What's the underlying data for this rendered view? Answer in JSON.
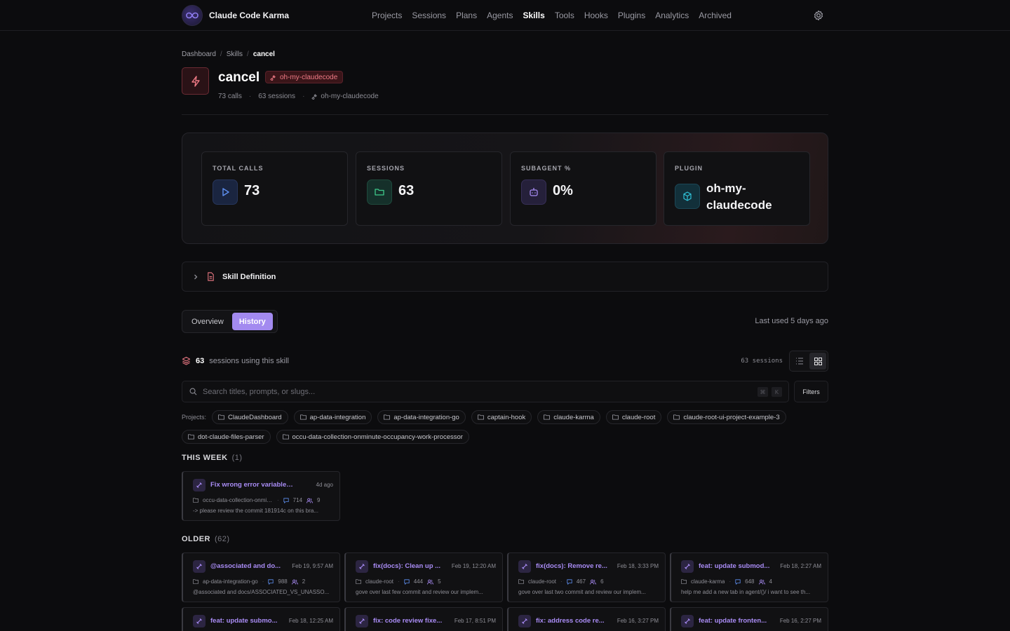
{
  "app": {
    "name": "Claude Code Karma"
  },
  "nav": [
    "Projects",
    "Sessions",
    "Plans",
    "Agents",
    "Skills",
    "Tools",
    "Hooks",
    "Plugins",
    "Analytics",
    "Archived"
  ],
  "nav_active": "Skills",
  "breadcrumb": [
    "Dashboard",
    "Skills",
    "cancel"
  ],
  "skill": {
    "name": "cancel",
    "plugin_badge": "oh-my-claudecode",
    "calls": "73 calls",
    "sessions": "63 sessions",
    "plugin": "oh-my-claudecode"
  },
  "stats": [
    {
      "label": "TOTAL CALLS",
      "value": "73",
      "icon": "play-icon",
      "color": "#5e8ff0"
    },
    {
      "label": "SESSIONS",
      "value": "63",
      "icon": "folder-icon",
      "color": "#3fc98b"
    },
    {
      "label": "SUBAGENT %",
      "value": "0%",
      "icon": "bot-icon",
      "color": "#a98cf5"
    },
    {
      "label": "PLUGIN",
      "value": "oh-my-claudecode",
      "icon": "package-icon",
      "color": "#2fc0d6"
    }
  ],
  "skill_definition_label": "Skill Definition",
  "tabs": [
    "Overview",
    "History"
  ],
  "active_tab": "History",
  "last_used": "Last used 5 days ago",
  "sessions_header": {
    "count": "63",
    "text": "sessions using this skill",
    "right_count": "63 sessions"
  },
  "search": {
    "placeholder": "Search titles, prompts, or slugs...",
    "value": "",
    "kbd1": "⌘",
    "kbd2": "K"
  },
  "filters_label": "Filters",
  "projects_label": "Projects:",
  "projects": [
    "ClaudeDashboard",
    "ap-data-integration",
    "ap-data-integration-go",
    "captain-hook",
    "claude-karma",
    "claude-root",
    "claude-root-ui-project-example-3",
    "dot-claude-files-parser",
    "occu-data-collection-onminute-occupancy-work-processor"
  ],
  "this_week": {
    "title": "THIS WEEK",
    "count": "(1)"
  },
  "older": {
    "title": "OLDER",
    "count": "(62)"
  },
  "this_week_cards": [
    {
      "title": "Fix wrong error variable and ...",
      "when": "4d ago",
      "project": "occu-data-collection-onminute...",
      "messages": "714",
      "agents": "9",
      "prompt": "-> please review the commit 181914c on this bra..."
    }
  ],
  "older_cards": [
    {
      "title": "@associated and do...",
      "when": "Feb 19, 9:57 AM",
      "project": "ap-data-integration-go",
      "messages": "988",
      "agents": "2",
      "prompt": "@associated and docs/ASSOCIATED_VS_UNASSO..."
    },
    {
      "title": "fix(docs): Clean up ...",
      "when": "Feb 19, 12:20 AM",
      "project": "claude-root",
      "messages": "444",
      "agents": "5",
      "prompt": "gove over last few commit and review our implem..."
    },
    {
      "title": "fix(docs): Remove re...",
      "when": "Feb 18, 3:33 PM",
      "project": "claude-root",
      "messages": "467",
      "agents": "6",
      "prompt": "gove over last two commit and review our implem..."
    },
    {
      "title": "feat: update submod...",
      "when": "Feb 18, 2:27 AM",
      "project": "claude-karma",
      "messages": "648",
      "agents": "4",
      "prompt": "help me add a new tab in agent/()/ i want to see th..."
    },
    {
      "title": "feat: update submo...",
      "when": "Feb 18, 12:25 AM",
      "project": "",
      "messages": "",
      "agents": "",
      "prompt": ""
    },
    {
      "title": "fix: code review fixe...",
      "when": "Feb 17, 8:51 PM",
      "project": "",
      "messages": "",
      "agents": "",
      "prompt": ""
    },
    {
      "title": "fix: address code re...",
      "when": "Feb 16, 3:27 PM",
      "project": "",
      "messages": "",
      "agents": "",
      "prompt": ""
    },
    {
      "title": "feat: update fronten...",
      "when": "Feb 16, 2:27 PM",
      "project": "",
      "messages": "",
      "agents": "",
      "prompt": ""
    }
  ]
}
